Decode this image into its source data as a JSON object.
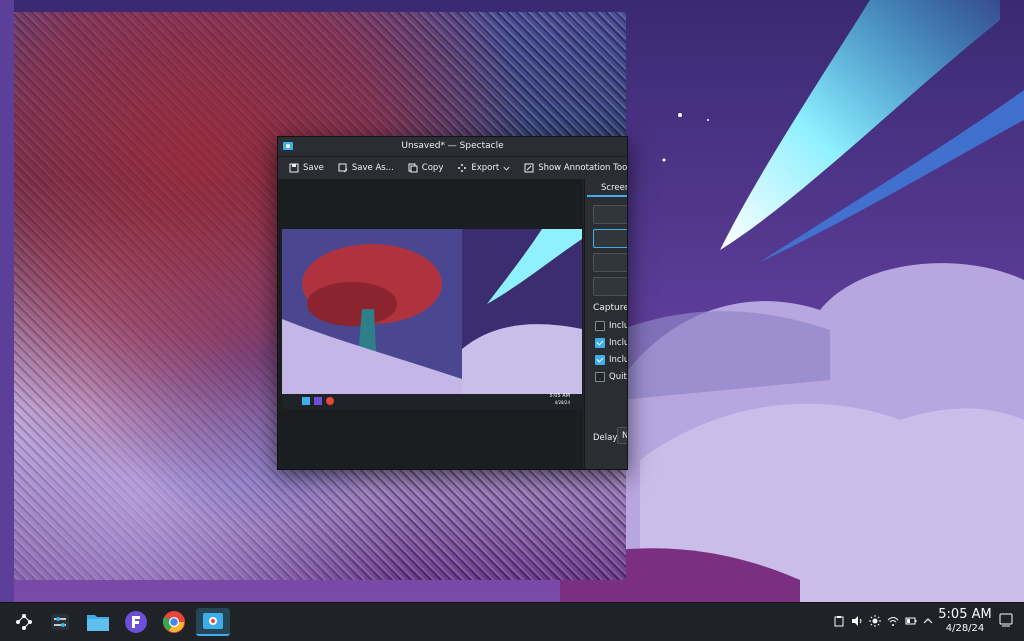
{
  "window": {
    "title": "Unsaved* — Spectacle",
    "toolbar": {
      "save": "Save",
      "save_as": "Save As...",
      "copy": "Copy",
      "export": "Export",
      "annotate": "Show Annotation Tools"
    },
    "side_panel": {
      "tab": "Screen",
      "capture_title": "Capture",
      "options": [
        {
          "label": "Includ",
          "checked": false
        },
        {
          "label": "Includ",
          "checked": true
        },
        {
          "label": "Includ",
          "checked": true
        },
        {
          "label": "Quit a",
          "checked": false
        }
      ],
      "delay_label": "Delay:",
      "delay_value": "N"
    }
  },
  "preview_tray": {
    "time": "5:05 AM",
    "date": "4/28/24"
  },
  "taskbar": {
    "apps": [
      "app-launcher",
      "system-settings",
      "file-manager",
      "fedora-media-writer",
      "chrome",
      "spectacle"
    ],
    "clock_time": "5:05 AM",
    "clock_date": "4/28/24"
  },
  "colors": {
    "accent": "#3daee9",
    "window_bg": "#232629",
    "panel_bg": "#1f2226"
  }
}
